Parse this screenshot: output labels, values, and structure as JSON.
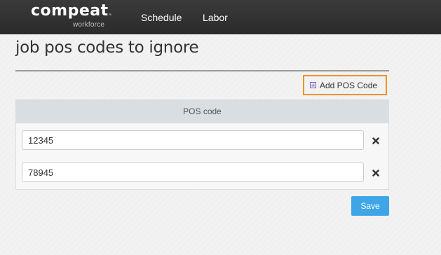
{
  "header": {
    "logo_word": "compeat",
    "logo_dot": ".",
    "logo_sub": "workforce",
    "nav": [
      {
        "label": "Schedule"
      },
      {
        "label": "Labor"
      }
    ]
  },
  "page": {
    "title": "job pos codes to ignore"
  },
  "actions": {
    "add_label": "Add POS Code",
    "add_icon": "plus-square-icon",
    "save_label": "Save"
  },
  "table": {
    "column_header": "POS code",
    "rows": [
      {
        "value": "12345",
        "remove_icon": "close-icon"
      },
      {
        "value": "78945",
        "remove_icon": "close-icon"
      }
    ]
  },
  "colors": {
    "topbar": "#2f2f2f",
    "highlight_border": "#f0912a",
    "save_button": "#3ea6e6",
    "table_header": "#d8dee2"
  }
}
